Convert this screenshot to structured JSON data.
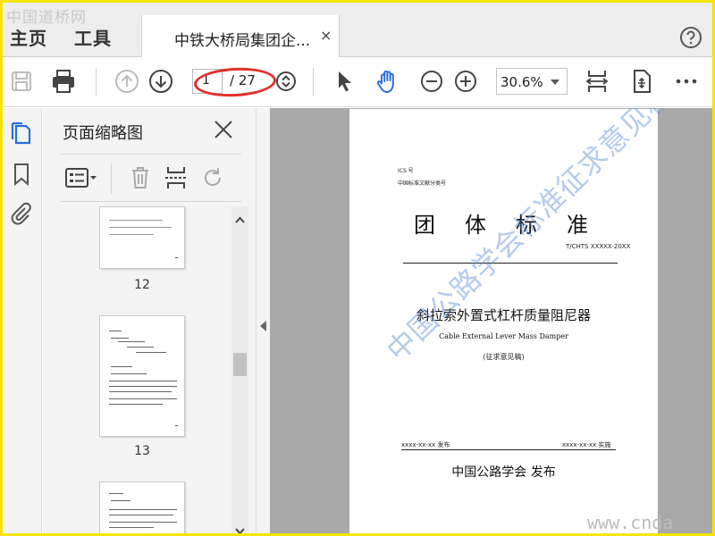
{
  "watermark_top": "中国道桥网",
  "watermark_bottom": "www.cnda",
  "menu": {
    "home": "主页",
    "tools": "工具"
  },
  "tab": {
    "title": "中铁大桥局集团企...",
    "close": "×"
  },
  "toolbar": {
    "page_current": "1",
    "page_total": "/ 27",
    "zoom": "30.6%",
    "icons": [
      "save-icon",
      "print-icon",
      "page-up-icon",
      "page-down-icon",
      "page-stepper-icon",
      "select-cursor-icon",
      "hand-tool-icon",
      "zoom-out-icon",
      "zoom-in-icon",
      "fit-page-icon",
      "full-screen-icon",
      "more-icon"
    ]
  },
  "thumbnails_panel": {
    "title": "页面缩略图",
    "pages": [
      {
        "label": "12"
      },
      {
        "label": "13"
      },
      {
        "label": ""
      }
    ]
  },
  "document": {
    "ics": "ICS 号",
    "classification": "中国标准文献分类号",
    "title": "团体标准",
    "standard_no": "T/CHTS XXXXX-20XX",
    "name_cn": "斜拉索外置式杠杆质量阻尼器",
    "name_en": "Cable External Lever Mass Damper",
    "draft": "(征求意见稿)",
    "issue_date": "xxxx-xx-xx 发布",
    "effective_date": "xxxx-xx-xx 实施",
    "publisher": "中国公路学会  发布",
    "watermark": "中国公路学会标准征求意见稿"
  },
  "colors": {
    "highlight": "#e0302a",
    "frame": "#f6e400",
    "watermark": "#5a8cd7"
  }
}
